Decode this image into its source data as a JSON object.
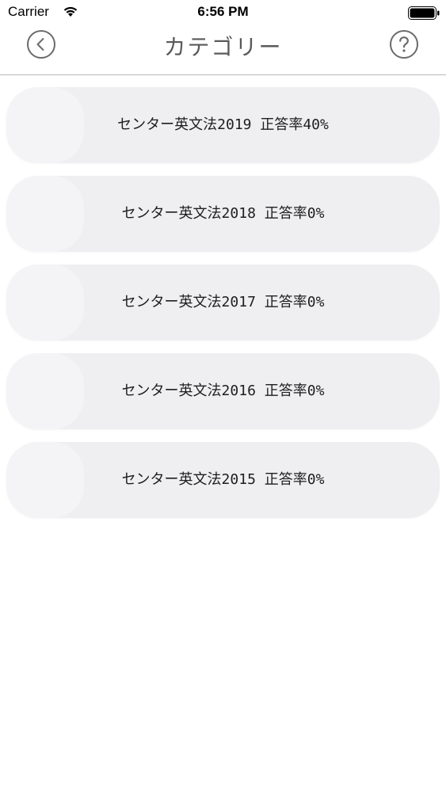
{
  "status_bar": {
    "carrier": "Carrier",
    "time": "6:56 PM"
  },
  "nav": {
    "title": "カテゴリー",
    "back_icon": "chevron-left-circle-icon",
    "help_icon": "question-circle-icon"
  },
  "categories": [
    {
      "label": "センター英文法2019 正答率40%"
    },
    {
      "label": "センター英文法2018 正答率0%"
    },
    {
      "label": "センター英文法2017 正答率0%"
    },
    {
      "label": "センター英文法2016 正答率0%"
    },
    {
      "label": "センター英文法2015 正答率0%"
    }
  ],
  "colors": {
    "item_background": "#efeef1",
    "nav_icon": "#6b6b6b",
    "divider": "#b9b9b9"
  }
}
